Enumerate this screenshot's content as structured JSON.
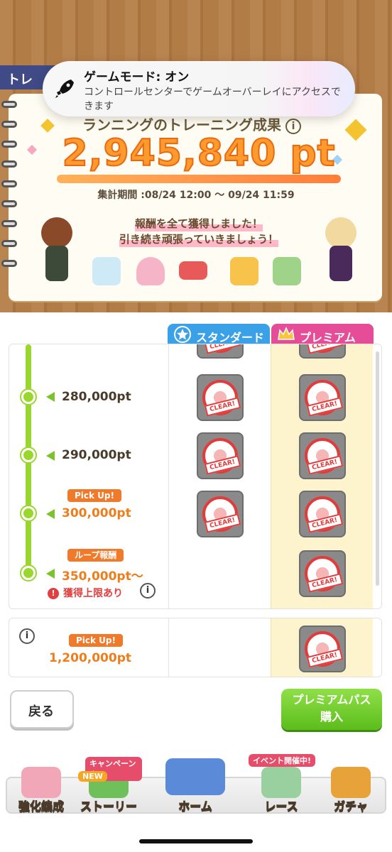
{
  "notification": {
    "title": "ゲームモード: オン",
    "body": "コントロールセンターでゲームオーバーレイにアクセスできます",
    "icon": "rocket-icon"
  },
  "banner": {
    "tab_label": "トレ",
    "ranking_title": "ランニングのトレーニング成果",
    "points": "2,945,840 pt",
    "period": "集計期間 :08/24 12:00 ～ 09/24 11:59",
    "reward_message_line1": "報酬を全て獲得しました！",
    "reward_message_line2": "引き続き頑張っていきましょう！",
    "info_symbol": "i"
  },
  "columns": {
    "standard_label": "スタンダード",
    "premium_label": "プレミアム"
  },
  "milestones": [
    {
      "points": "280,000pt",
      "badge": "",
      "standard_clear": true,
      "premium_clear": true
    },
    {
      "points": "290,000pt",
      "badge": "",
      "standard_clear": true,
      "premium_clear": true
    },
    {
      "points": "300,000pt",
      "badge": "Pick Up!",
      "standard_clear": true,
      "premium_clear": true
    },
    {
      "points": "350,000pt～",
      "badge": "ループ報酬",
      "standard_clear": false,
      "premium_clear": true
    }
  ],
  "limit_text": "獲得上限あり",
  "limit_symbol": "!",
  "bonus": {
    "badge": "Pick Up!",
    "points": "1,200,000pt",
    "premium_clear": true
  },
  "clear_label": "CLEAR!",
  "buttons": {
    "back": "戻る",
    "premium_pass_line1": "プレミアムパス",
    "premium_pass_line2": "購入"
  },
  "nav": {
    "items": [
      {
        "label": "強化編成"
      },
      {
        "label": "ストーリー",
        "badge": "キャンペーン中",
        "new": "NEW"
      },
      {
        "label": "ホーム"
      },
      {
        "label": "レース",
        "badge": "イベント開催中!"
      },
      {
        "label": "ガチャ"
      }
    ]
  },
  "colors": {
    "accent_green": "#9bd62f",
    "standard_blue": "#3aa0e8",
    "premium_pink": "#e64d98",
    "points_orange": "#ff9a2e"
  }
}
